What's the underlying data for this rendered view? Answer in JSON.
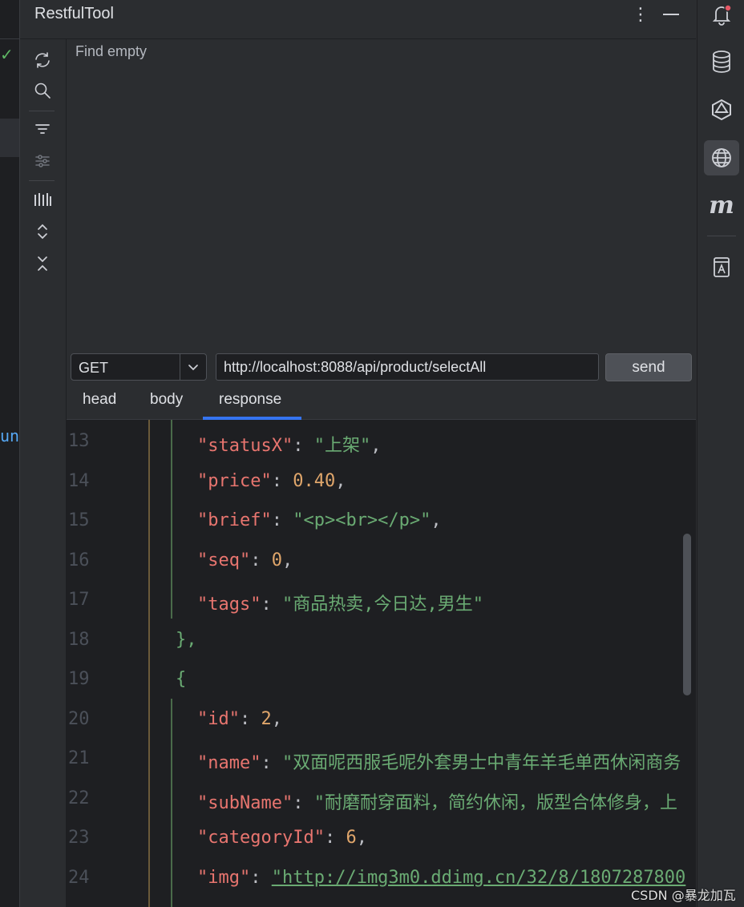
{
  "tool_window": {
    "title": "RestfulTool",
    "find_status": "Find empty"
  },
  "icons": {
    "more": "more-vertical-icon",
    "minimize": "minimize-icon",
    "refresh": "refresh-icon",
    "search": "search-icon",
    "filter": "filter-icon",
    "settings": "settings-icon",
    "show_bars": "bars-icon",
    "expand": "expand-icon",
    "collapse": "collapse-icon",
    "notifications": "bell-icon",
    "database": "database-icon",
    "ai": "ai-assistant-icon",
    "globe": "globe-icon",
    "maven": "maven-icon",
    "bookmark": "bookmark-icon"
  },
  "request": {
    "method": "GET",
    "url": "http://localhost:8088/api/product/selectAll",
    "send_label": "send"
  },
  "tabs": [
    {
      "label": "head"
    },
    {
      "label": "body"
    },
    {
      "label": "response",
      "active": true
    }
  ],
  "left_fragment": "un",
  "editor": {
    "lines": [
      {
        "num": "13",
        "key": "\"statusX\"",
        "sep": ": ",
        "value": "\"上架\"",
        "tail": ","
      },
      {
        "num": "14",
        "key": "\"price\"",
        "sep": ": ",
        "value": "0.40",
        "tail": ","
      },
      {
        "num": "15",
        "key": "\"brief\"",
        "sep": ": ",
        "value": "\"<p><br></p>\"",
        "tail": ","
      },
      {
        "num": "16",
        "key": "\"seq\"",
        "sep": ": ",
        "value": "0",
        "tail": ","
      },
      {
        "num": "17",
        "key": "\"tags\"",
        "sep": ": ",
        "value": "\"商品热卖,今日达,男生\"",
        "tail": ""
      },
      {
        "num": "18",
        "text": "},"
      },
      {
        "num": "19",
        "text": "{"
      },
      {
        "num": "20",
        "key": "\"id\"",
        "sep": ": ",
        "value": "2",
        "tail": ","
      },
      {
        "num": "21",
        "key": "\"name\"",
        "sep": ": ",
        "value": "\"双面呢西服毛呢外套男士中青年羊毛单西休闲商务",
        "tail": ""
      },
      {
        "num": "22",
        "key": "\"subName\"",
        "sep": ": ",
        "value": "\"耐磨耐穿面料，简约休闲，版型合体修身，上",
        "tail": ""
      },
      {
        "num": "23",
        "key": "\"categoryId\"",
        "sep": ": ",
        "value": "6",
        "tail": ","
      },
      {
        "num": "24",
        "key": "\"img\"",
        "sep": ": ",
        "value": "\"http://img3m0.ddimg.cn/32/8/1807287800",
        "tail": ""
      }
    ]
  },
  "watermark": "CSDN @暴龙加瓦",
  "colors": {
    "accent": "#3574f0",
    "key": "#e8756f",
    "string": "#6aab73",
    "number": "#e0a66b",
    "notification_dot": "#e55765"
  }
}
